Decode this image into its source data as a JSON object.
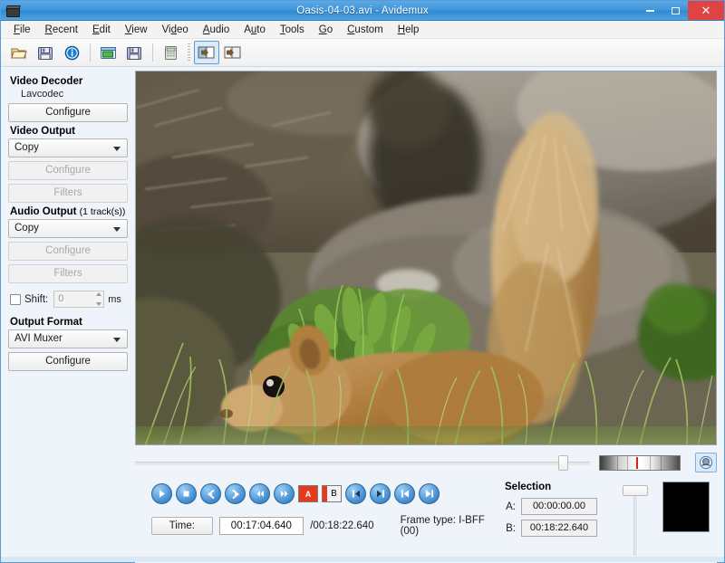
{
  "window": {
    "title": "Oasis-04-03.avi - Avidemux",
    "icon": "clapperboard-icon",
    "minimize_label": "–",
    "maximize_label": "□",
    "close_label": "✕"
  },
  "menubar": {
    "items": [
      {
        "label": "File",
        "mnemonic": "F"
      },
      {
        "label": "Recent",
        "mnemonic": "R"
      },
      {
        "label": "Edit",
        "mnemonic": "E"
      },
      {
        "label": "View",
        "mnemonic": "V"
      },
      {
        "label": "Video",
        "mnemonic": "d"
      },
      {
        "label": "Audio",
        "mnemonic": "A"
      },
      {
        "label": "Auto",
        "mnemonic": "u"
      },
      {
        "label": "Tools",
        "mnemonic": "T"
      },
      {
        "label": "Go",
        "mnemonic": "G"
      },
      {
        "label": "Custom",
        "mnemonic": "C"
      },
      {
        "label": "Help",
        "mnemonic": "H"
      }
    ]
  },
  "toolbar": {
    "buttons": [
      {
        "name": "open-file-icon",
        "tooltip": "Open"
      },
      {
        "name": "save-file-icon",
        "tooltip": "Save"
      },
      {
        "name": "info-icon",
        "tooltip": "Information"
      },
      {
        "name": "open-video-icon",
        "tooltip": "Open Video"
      },
      {
        "name": "save-video-icon",
        "tooltip": "Save Video"
      },
      {
        "name": "calculator-icon",
        "tooltip": "Calculator"
      },
      {
        "name": "set-marker-a-icon",
        "tooltip": "Set Marker A",
        "active": true
      },
      {
        "name": "set-marker-b-icon",
        "tooltip": "Set Marker B",
        "active": false
      }
    ]
  },
  "sidebar": {
    "video_decoder": {
      "title": "Video Decoder",
      "codec": "Lavcodec",
      "configure_label": "Configure"
    },
    "video_output": {
      "title": "Video Output",
      "selected": "Copy",
      "options": [
        "Copy"
      ],
      "configure_label": "Configure",
      "filters_label": "Filters"
    },
    "audio_output": {
      "title": "Audio Output",
      "title_suffix": "(1 track(s))",
      "selected": "Copy",
      "options": [
        "Copy"
      ],
      "configure_label": "Configure",
      "filters_label": "Filters",
      "shift_label": "Shift:",
      "shift_value": "0",
      "shift_unit": "ms",
      "shift_checked": false
    },
    "output_format": {
      "title": "Output Format",
      "selected": "AVI Muxer",
      "options": [
        "AVI Muxer"
      ],
      "configure_label": "Configure"
    }
  },
  "video": {
    "description": "red-squirrel-in-grass-beside-rocks"
  },
  "seek": {
    "position_percent": 93,
    "vu_meter_marker_percent": 46,
    "audio_button_icon": "speaker-icon"
  },
  "transport": {
    "buttons": [
      {
        "name": "play-button",
        "icon": "play"
      },
      {
        "name": "stop-button",
        "icon": "stop"
      },
      {
        "name": "previous-frame-button",
        "icon": "back"
      },
      {
        "name": "next-frame-button",
        "icon": "forward"
      },
      {
        "name": "rewind-button",
        "icon": "rewind"
      },
      {
        "name": "fast-forward-button",
        "icon": "ffwd"
      },
      {
        "name": "marker-a-button",
        "icon": "marker-a",
        "label": "A"
      },
      {
        "name": "marker-b-button",
        "icon": "marker-b",
        "label": "B"
      },
      {
        "name": "go-to-marker-a-button",
        "icon": "to-a"
      },
      {
        "name": "go-to-marker-b-button",
        "icon": "to-b"
      },
      {
        "name": "previous-keyframe-button",
        "icon": "prev-key"
      },
      {
        "name": "next-keyframe-button",
        "icon": "next-key"
      }
    ]
  },
  "status": {
    "time_label": "Time:",
    "current_time": "00:17:04.640",
    "total_time": "/00:18:22.640",
    "frame_type": "Frame type:  I-BFF (00)"
  },
  "selection": {
    "title": "Selection",
    "a_label": "A:",
    "a_value": "00:00:00.00",
    "b_label": "B:",
    "b_value": "00:18:22.640"
  },
  "colors": {
    "titlebar": "#3f96dc",
    "close_button": "#e04343",
    "accent": "#5b9bd5",
    "panel_bg": "#eef4fa",
    "marker_red": "#e43b20"
  }
}
